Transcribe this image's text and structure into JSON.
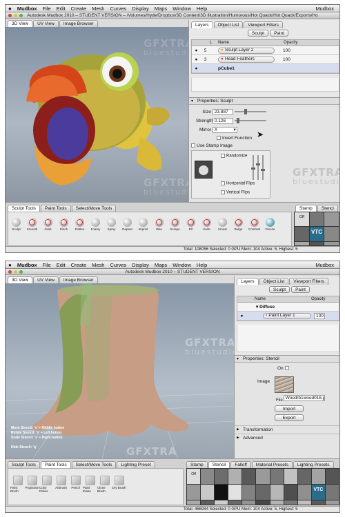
{
  "screenshot1": {
    "menubar": {
      "apple": "",
      "app": "Mudbox",
      "items": [
        "File",
        "Edit",
        "Create",
        "Mesh",
        "Curves",
        "Display",
        "Maps",
        "Window",
        "Help"
      ],
      "right": "Mudbox"
    },
    "title": "Autodesk Mudbox 2010 – STUDENT VERSION – /Volumes/Hyde/Dropbox/3D Content/3D Illustration/Humorous/Hot Quack/Hot Quack/Exports/Ho",
    "view_tabs": [
      "3D View",
      "UV View",
      "Image Browser"
    ],
    "panel_tabs": [
      "Layers",
      "Object List",
      "Viewport Filters"
    ],
    "mode_buttons": [
      "Sculpt",
      "Paint"
    ],
    "layer_columns": [
      "",
      "",
      "L",
      "Name",
      "Opacity"
    ],
    "layers": [
      {
        "vis": "●",
        "num": "5",
        "name": "Sculpt Layer 2",
        "opacity": "100"
      },
      {
        "vis": "●",
        "num": "3",
        "name": "Head Feathers",
        "opacity": "100"
      },
      {
        "vis": "●",
        "num": "",
        "name": "pCube1",
        "opacity": ""
      }
    ],
    "properties_title": "Properties: Sculpt",
    "size": {
      "label": "Size",
      "value": "23.887"
    },
    "strength": {
      "label": "Strength",
      "value": "0.126"
    },
    "mirror": {
      "label": "Mirror",
      "value": "X"
    },
    "invert_label": "Invert Function",
    "stamp_label": "Use Stamp Image",
    "randomize_label": "Randomize",
    "hflip_label": "Horizontal Flips",
    "vflip_label": "Vertical Flips",
    "tool_tabs": [
      "Sculpt Tools",
      "Paint Tools",
      "Select/Move Tools"
    ],
    "tools": [
      "Sculpt",
      "Smooth",
      "Grab",
      "Pinch",
      "Flatten",
      "Foamy",
      "Spray",
      "Repeat",
      "Imprint",
      "Wax",
      "Scrape",
      "Fill",
      "Knife",
      "Smear",
      "Bulge",
      "Contrast",
      "Freeze"
    ],
    "tray_tabs": [
      "Stamp",
      "Stenci"
    ],
    "tray_off": "Off",
    "status": "Total: 108056  Selected: 0  GPU Mem: 104  Active: 5, Highest: 5",
    "watermark": {
      "brand": "GFXTRA",
      "studio": "bluestudio"
    }
  },
  "screenshot2": {
    "menubar": {
      "apple": "",
      "app": "Mudbox",
      "items": [
        "File",
        "Edit",
        "Create",
        "Mesh",
        "Curves",
        "Display",
        "Maps",
        "Window",
        "Help"
      ],
      "right": "Mudbox"
    },
    "title": "Autodesk Mudbox 2010 – STUDENT VERSION",
    "view_tabs": [
      "3D View",
      "UV View",
      "Image Browser"
    ],
    "panel_tabs": [
      "Layers",
      "Object List",
      "Viewport Filters"
    ],
    "mode_buttons": [
      "Sculpt",
      "Paint"
    ],
    "layer_columns": [
      "",
      "",
      "Name",
      "Opacity"
    ],
    "layers": [
      {
        "vis": "",
        "name": "▾ Diffuse",
        "opacity": ""
      },
      {
        "vis": "●",
        "name": "Paint Layer 1",
        "opacity": "100"
      }
    ],
    "properties_title": "Properties: Stencil",
    "on_label": "On",
    "image_label": "Image",
    "file_label": "File",
    "file_value": "Wood/b1wood016.jpg",
    "import_label": "Import",
    "export_label": "Export",
    "transformation_label": "Transformation",
    "advanced_label": "Advanced",
    "hotkeys": [
      "Move Stencil: 's' + Middle button",
      "Rotate Stencil: 's' + Left button",
      "Scale Stencil: 's' + Right button",
      "",
      "Hide Stencil: 'q'"
    ],
    "tool_tabs": [
      "Sculpt Tools",
      "Paint Tools",
      "Select/Move Tools",
      "Lighting Preset"
    ],
    "tools": [
      "Paint Brush",
      "Projection",
      "Color Picker",
      "Airbrush",
      "Pencil",
      "Paint Erase",
      "Clone Brush",
      "Dry Brush"
    ],
    "tray_tabs": [
      "Stamp",
      "Stencil",
      "Falloff",
      "Material Presets",
      "Lighting Presets"
    ],
    "tray_off": "Off",
    "status": "Total: 466944  Selected: 0  GPU Mem: 104  Active: 5, Highest: 5",
    "watermark": {
      "brand": "GFXTRA",
      "studio": "bluestudio"
    }
  },
  "colors": {
    "accent_selected": "#d8dcef",
    "brush_red": "#d22",
    "tray_badge": "#2a6d8a"
  }
}
